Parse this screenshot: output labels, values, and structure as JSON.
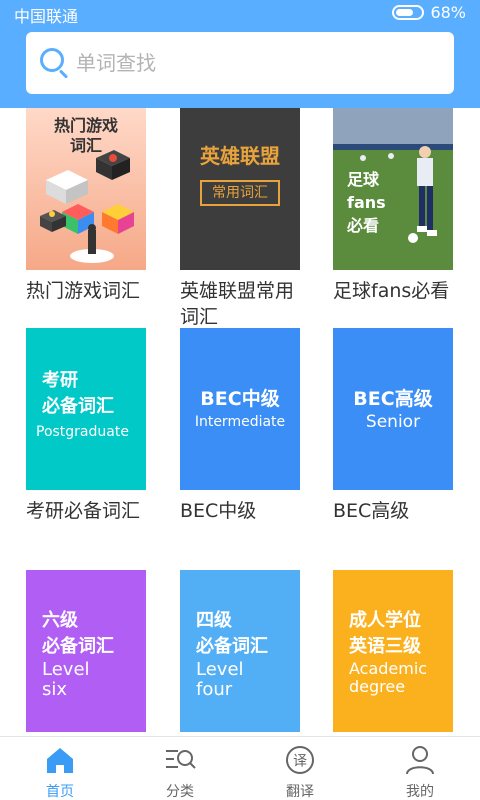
{
  "status_bar": {
    "carrier": "中国联通",
    "battery": "68%",
    "battery_level": 0.68
  },
  "search": {
    "placeholder": "单词查找"
  },
  "categories": [
    {
      "label": "热门游戏词汇",
      "cover_lines": [
        "热门游戏",
        "词汇"
      ]
    },
    {
      "label": "英雄联盟常用词汇",
      "cover_title": "英雄联盟",
      "cover_tag": "常用词汇"
    },
    {
      "label": "足球fans必看",
      "cover_lines": [
        "足球",
        "fans",
        "必看"
      ]
    },
    {
      "label": "考研必备词汇",
      "cover_lines": [
        "考研",
        "必备词汇"
      ],
      "cover_sub": "Postgraduate"
    },
    {
      "label": "BEC中级",
      "cover_lines": [
        "BEC中级"
      ],
      "cover_sub": "Intermediate"
    },
    {
      "label": "BEC高级",
      "cover_lines": [
        "BEC高级"
      ],
      "cover_sub": "Senior"
    },
    {
      "cover_lines": [
        "六级",
        "必备词汇"
      ],
      "cover_sub_lines": [
        "Level",
        "six"
      ]
    },
    {
      "cover_lines": [
        "四级",
        "必备词汇"
      ],
      "cover_sub_lines": [
        "Level",
        "four"
      ]
    },
    {
      "cover_lines": [
        "成人学位",
        "英语三级"
      ],
      "cover_sub_lines": [
        "Academic",
        "degree"
      ]
    }
  ],
  "tabs": [
    {
      "label": "首页",
      "icon": "home-icon",
      "active": true
    },
    {
      "label": "分类",
      "icon": "category-search-icon",
      "active": false
    },
    {
      "label": "翻译",
      "icon": "translate-icon",
      "icon_text": "译",
      "active": false
    },
    {
      "label": "我的",
      "icon": "user-icon",
      "active": false
    }
  ],
  "colors": {
    "accent": "#5aaeff",
    "active_tab": "#3a9cf5"
  }
}
